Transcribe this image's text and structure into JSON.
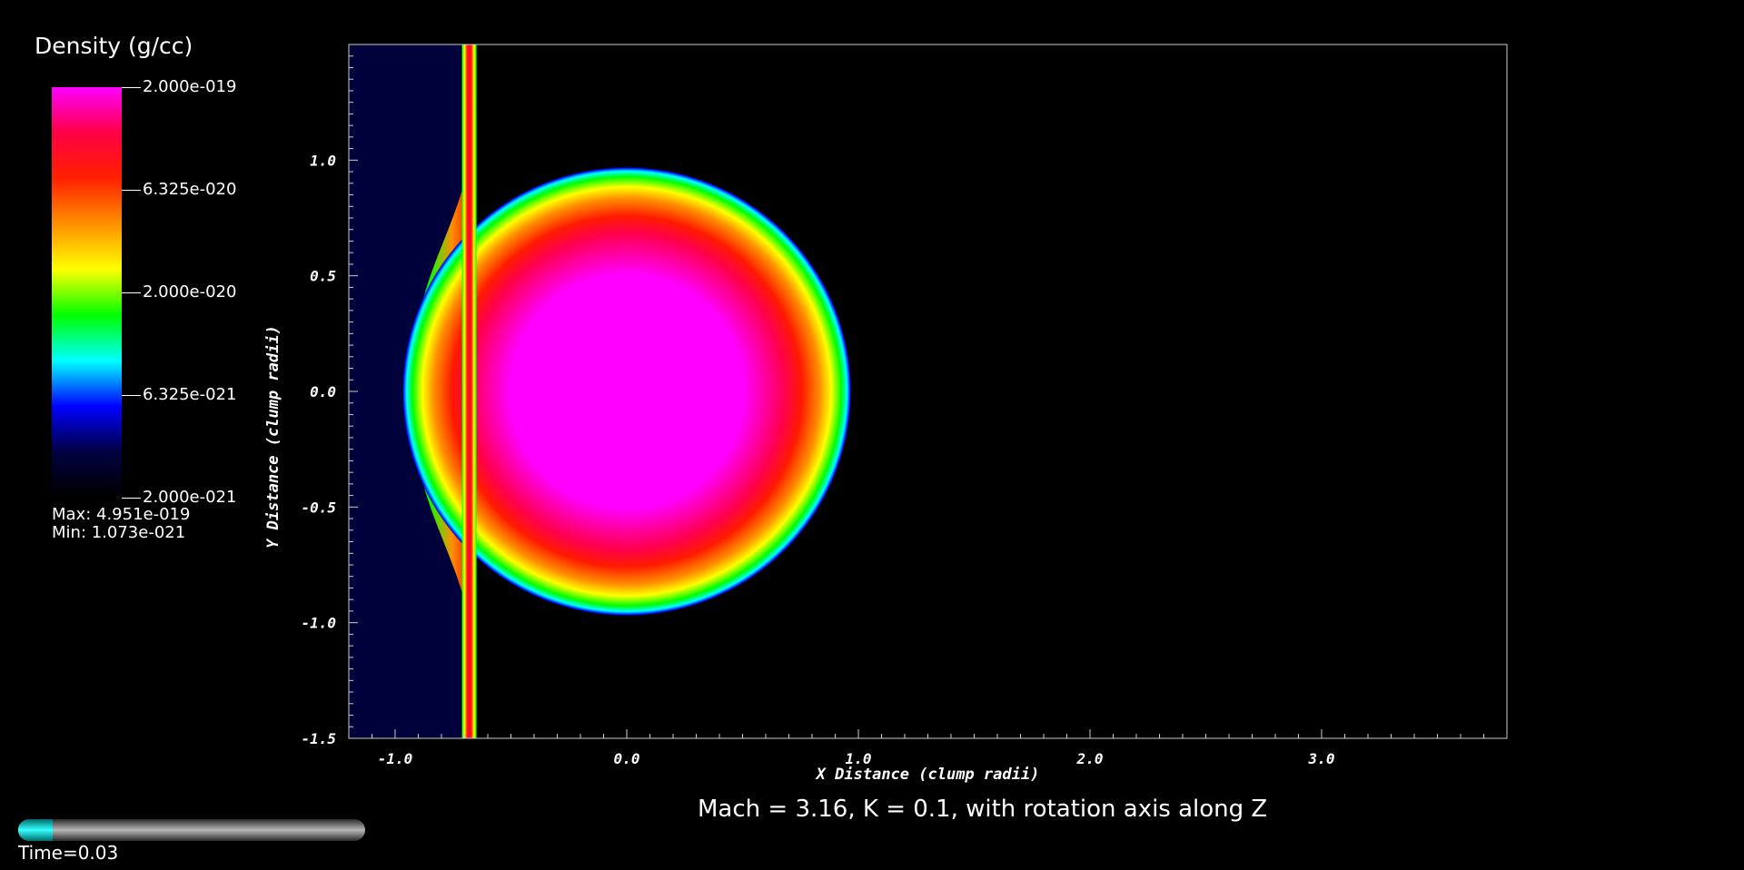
{
  "legend": {
    "title": "Density (g/cc)",
    "labels": [
      "2.000e-019",
      "6.325e-020",
      "2.000e-020",
      "6.325e-021",
      "2.000e-021"
    ],
    "max_label": "Max:  4.951e-019",
    "min_label": "Min:  1.073e-021",
    "colormap": [
      "#ff00ff",
      "#ff0044",
      "#ff2000",
      "#ff9000",
      "#ffff00",
      "#00ff00",
      "#00ffff",
      "#0000ff",
      "#000040",
      "#000000"
    ]
  },
  "caption": "Mach = 3.16, K = 0.1, with rotation axis along Z",
  "time": {
    "label": "Time=0.03",
    "progress": 0.1
  },
  "chart_data": {
    "type": "heatmap",
    "title": "Density (g/cc)",
    "xlabel": "X Distance (clump radii)",
    "ylabel": "Y Distance (clump radii)",
    "xlim": [
      -1.2,
      3.8
    ],
    "ylim": [
      -1.5,
      1.5
    ],
    "x_ticks": [
      -1.0,
      0.0,
      1.0,
      2.0,
      3.0
    ],
    "x_tick_labels": [
      "-1.0",
      "0.0",
      "1.0",
      "2.0",
      "3.0"
    ],
    "y_ticks": [
      1.0,
      0.5,
      0.0,
      -0.5,
      -1.0,
      -1.5
    ],
    "y_tick_labels": [
      "1.0",
      "0.5",
      "0.0",
      "-0.5",
      "-1.0",
      "-1.5"
    ],
    "clump": {
      "center": [
        0.0,
        0.0
      ],
      "radius": 0.97
    },
    "shock_x": -0.68,
    "upstream_x_range": [
      -1.2,
      -0.68
    ],
    "colorbar_range": [
      2e-21,
      2e-19
    ],
    "colorbar_scale": "log",
    "data_max": 4.951e-19,
    "data_min": 1.073e-21
  }
}
